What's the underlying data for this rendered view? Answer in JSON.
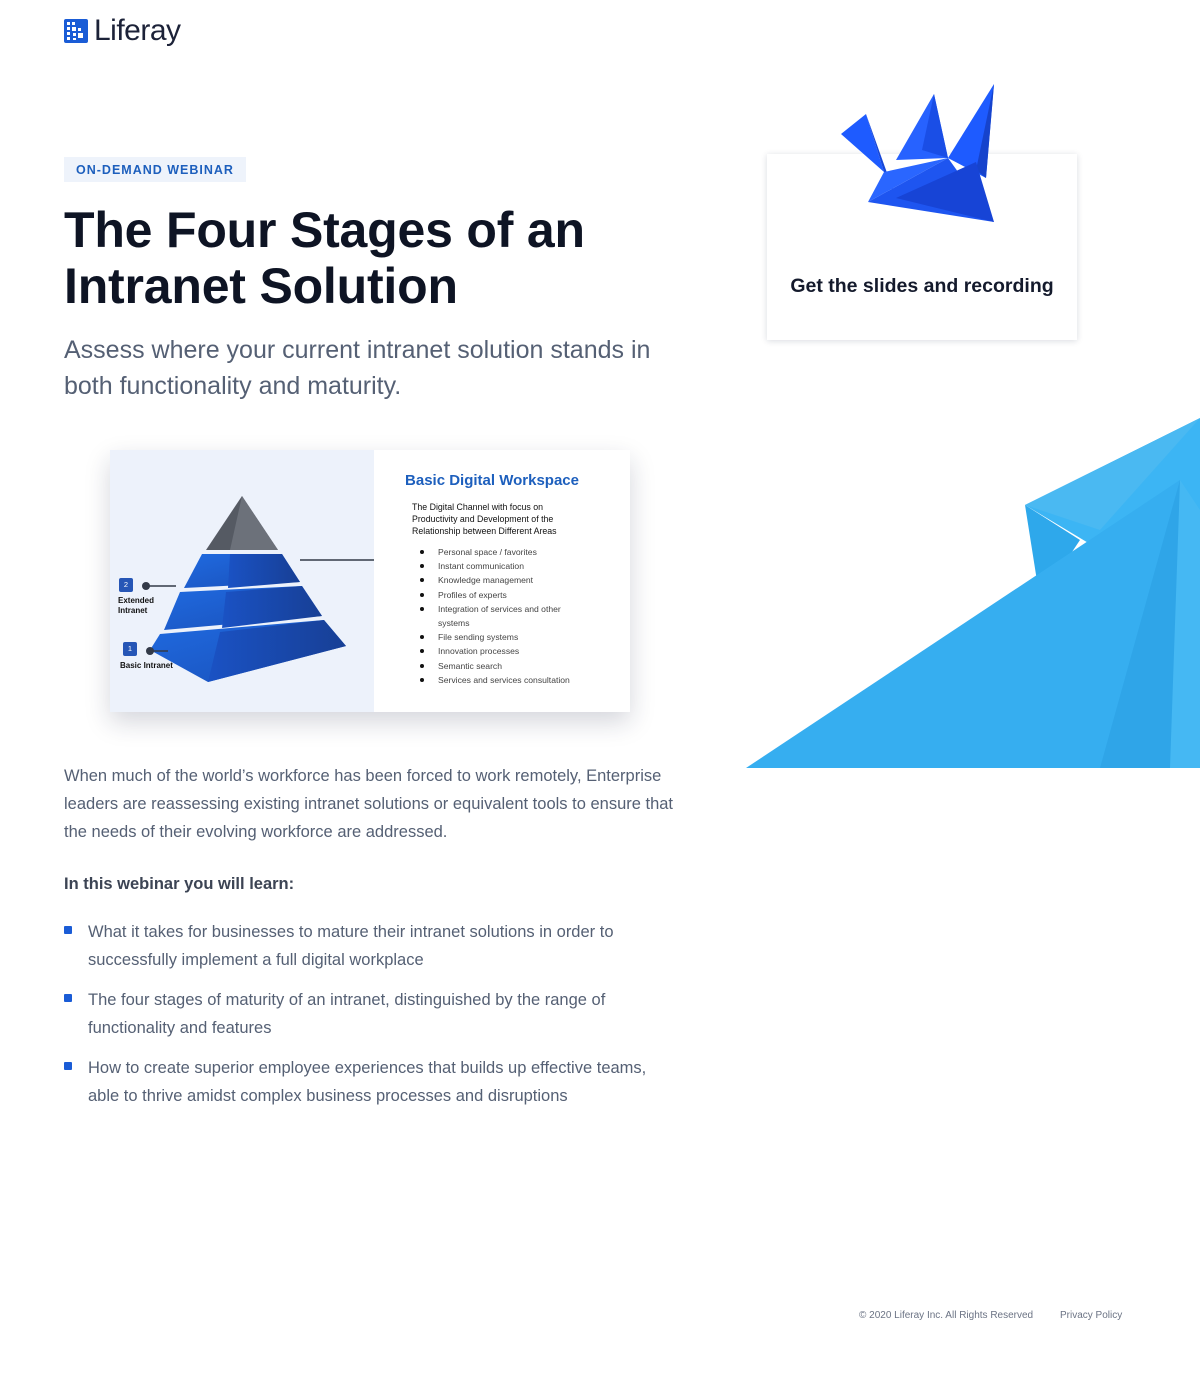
{
  "brand": {
    "logo_text": "Liferay",
    "colors": {
      "primary_blue": "#1a5cd6",
      "sky_blue": "#33aff0",
      "crane_blue": "#1e5bff"
    }
  },
  "hero": {
    "badge": "ON-DEMAND WEBINAR",
    "title_line1": "The Four Stages of an",
    "title_line2": "Intranet Solution",
    "subtitle": "Assess where your current intranet solution stands in both functionality and maturity."
  },
  "slide": {
    "heading": "Basic Digital Workspace",
    "description": "The Digital Channel with focus on Productivity and Development of the Relationship between Different Areas",
    "items": [
      "Personal space / favorites",
      "Instant communication",
      "Knowledge management",
      "Profiles of experts",
      "Integration of services and other systems",
      "File sending systems",
      "Innovation processes",
      "Semantic search",
      "Services and services consultation"
    ],
    "level2_number": "2",
    "level2_label": "Extended Intranet",
    "level1_number": "1",
    "level1_label": "Basic Intranet"
  },
  "body": {
    "paragraph": "When much of the world’s workforce has been forced to work remotely, Enterprise leaders are reassessing existing intranet solutions or equivalent tools to ensure that the needs of their evolving workforce are addressed.",
    "learn_heading": "In this webinar you will learn:",
    "learn_items": [
      "What it takes for businesses to mature their intranet solutions in order to successfully implement a full digital workplace",
      "The four stages of maturity of an intranet, distinguished by the range of functionality and features",
      "How to create superior employee experiences that builds up effective teams, able to thrive amidst complex business processes and disruptions"
    ]
  },
  "card": {
    "cta_text": "Get the slides and recording",
    "icon": "origami-crane-icon"
  },
  "footer": {
    "copyright": "© 2020 Liferay Inc. All Rights Reserved",
    "privacy_link": "Privacy Policy"
  }
}
